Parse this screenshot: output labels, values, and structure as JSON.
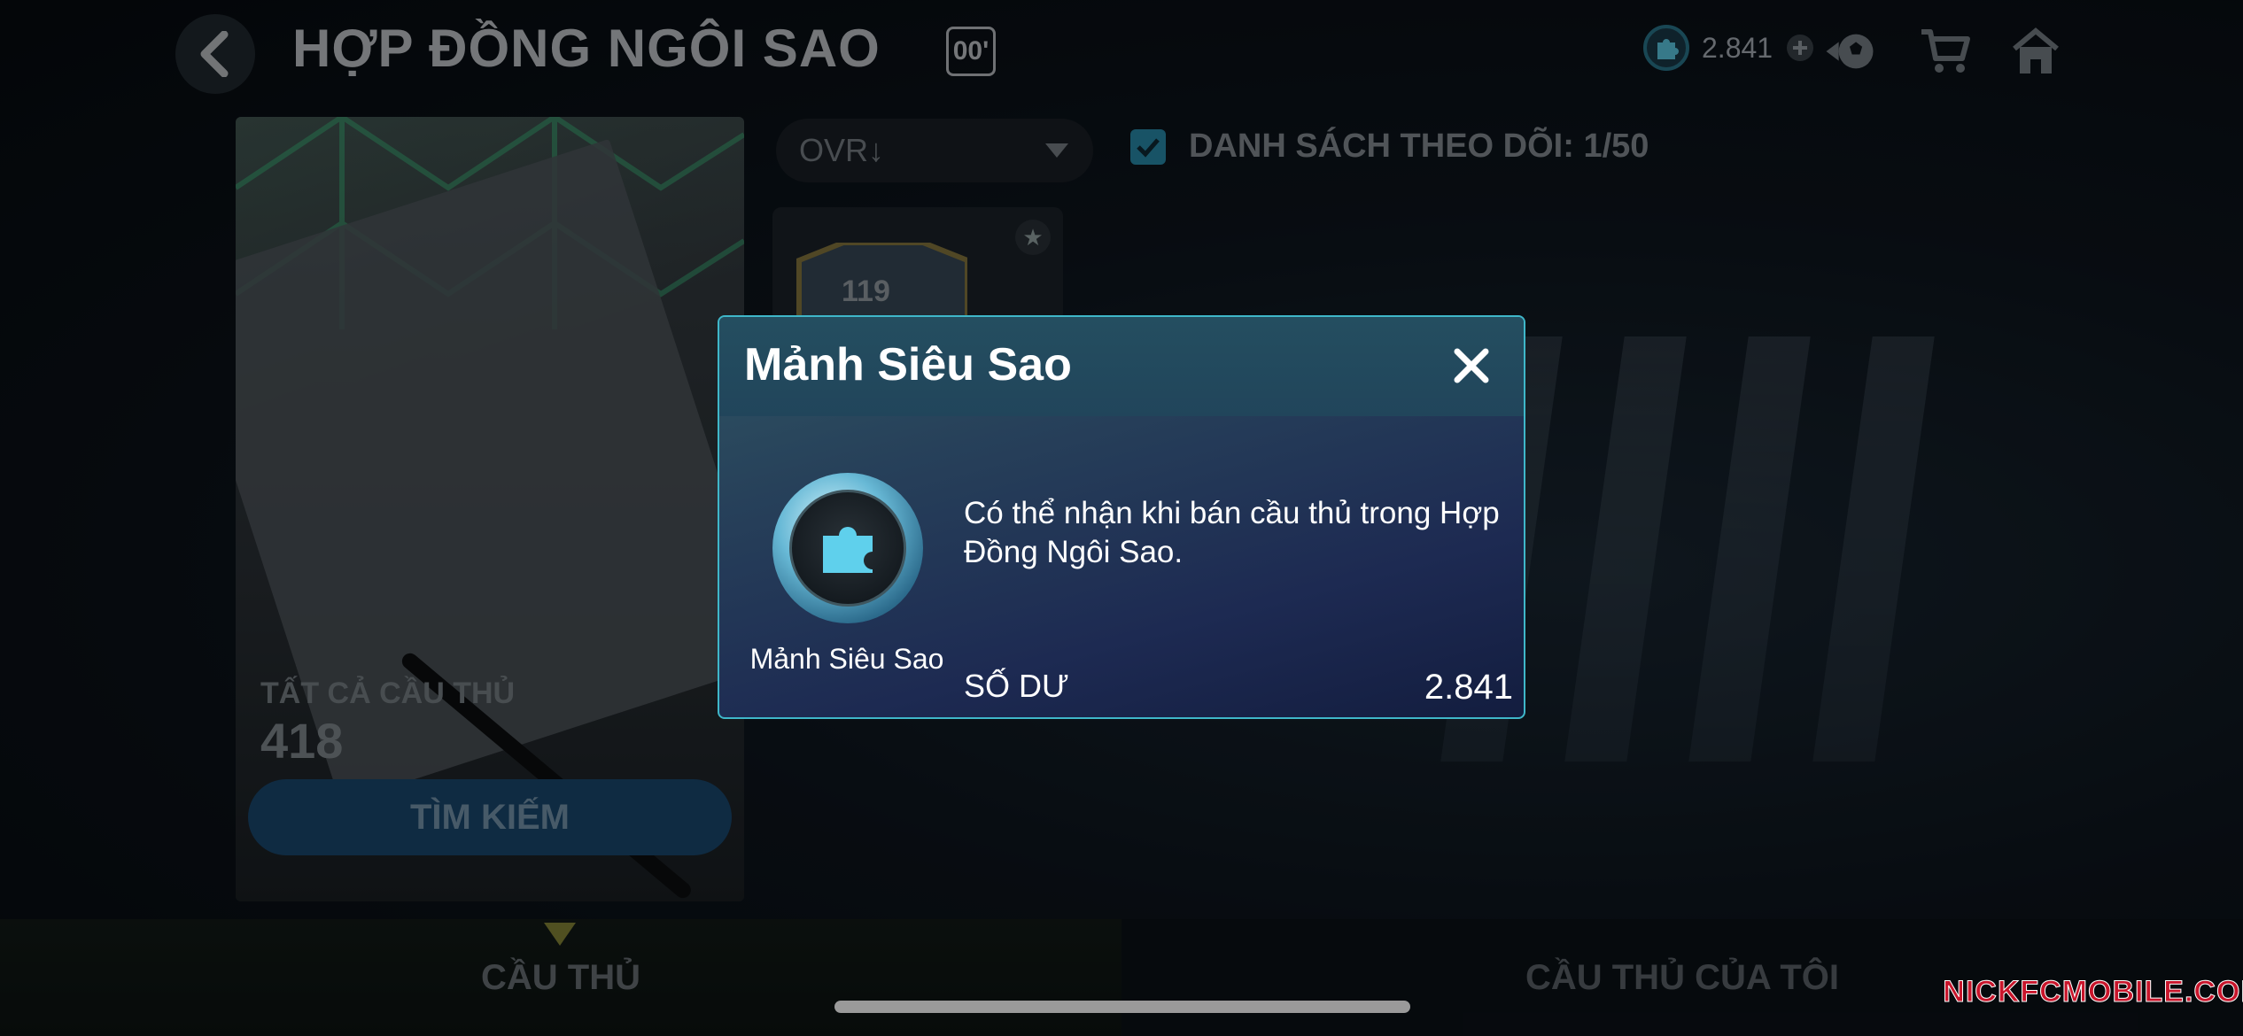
{
  "header": {
    "title": "HỢP ĐỒNG NGÔI SAO",
    "badge": "00'",
    "currency_amount": "2.841"
  },
  "icons": {
    "back": "chevron-left-icon",
    "currency": "puzzle-piece-icon",
    "add": "plus-icon",
    "market": "ball-icon",
    "shop": "cart-icon",
    "home": "home-icon"
  },
  "left_panel": {
    "label": "TẤT CẢ CẦU THỦ",
    "count": "418",
    "search_button": "TÌM KIẾM"
  },
  "filters": {
    "sort_value": "OVR↓",
    "watchlist_label": "DANH SÁCH THEO DÕI: 1/50",
    "watchlist_checked": true
  },
  "player_card": {
    "ovr": "119"
  },
  "modal": {
    "title": "Mảnh Siêu Sao",
    "item_name": "Mảnh Siêu Sao",
    "description": "Có thể nhận khi bán cầu thủ trong Hợp Đồng Ngôi Sao.",
    "balance_label": "SỐ DƯ",
    "balance_value": "2.841"
  },
  "tabs": [
    {
      "label": "CẦU THỦ",
      "active": true
    },
    {
      "label": "CẦU THỦ CỦA TÔI",
      "active": false
    }
  ],
  "watermark": "NICKFCMOBILE.COM",
  "colors": {
    "accent": "#3fb7c9",
    "search_button": "#1b4a72",
    "checkbox": "#2a8fb0",
    "watermark": "#c8152b"
  }
}
